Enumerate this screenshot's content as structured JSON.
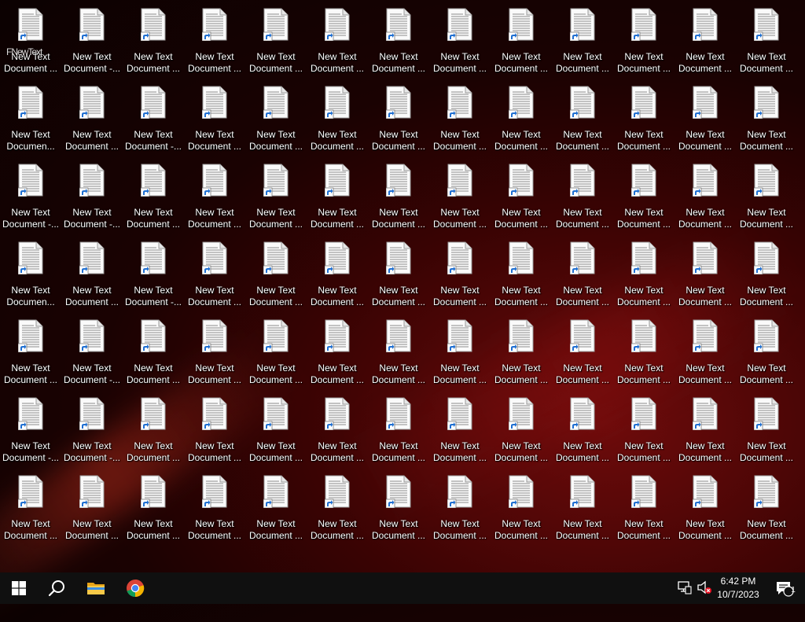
{
  "desktop": {
    "icon_title": "New Text",
    "first_icon_overlay": "FNewText",
    "rows": [
      [
        "Document ...",
        "Document -...",
        "Document ...",
        "Document ...",
        "Document ...",
        "Document ...",
        "Document ...",
        "Document ...",
        "Document ...",
        "Document ...",
        "Document ...",
        "Document ...",
        "Document ..."
      ],
      [
        "Documen...",
        "Document ...",
        "Document -...",
        "Document ...",
        "Document ...",
        "Document ...",
        "Document ...",
        "Document ...",
        "Document ...",
        "Document ...",
        "Document ...",
        "Document ...",
        "Document ..."
      ],
      [
        "Document -...",
        "Document -...",
        "Document ...",
        "Document ...",
        "Document ...",
        "Document ...",
        "Document ...",
        "Document ...",
        "Document ...",
        "Document ...",
        "Document ...",
        "Document ...",
        "Document ..."
      ],
      [
        "Documen...",
        "Document ...",
        "Document -...",
        "Document ...",
        "Document ...",
        "Document ...",
        "Document ...",
        "Document ...",
        "Document ...",
        "Document ...",
        "Document ...",
        "Document ...",
        "Document ..."
      ],
      [
        "Document ...",
        "Document -...",
        "Document ...",
        "Document ...",
        "Document ...",
        "Document ...",
        "Document ...",
        "Document ...",
        "Document ...",
        "Document ...",
        "Document ...",
        "Document ...",
        "Document ..."
      ],
      [
        "Document -...",
        "Document -...",
        "Document ...",
        "Document ...",
        "Document ...",
        "Document ...",
        "Document ...",
        "Document ...",
        "Document ...",
        "Document ...",
        "Document ...",
        "Document ...",
        "Document ..."
      ],
      [
        "Document ...",
        "Document ...",
        "Document ...",
        "Document ...",
        "Document ...",
        "Document ...",
        "Document ...",
        "Document ...",
        "Document ...",
        "Document ...",
        "Document ...",
        "Document ...",
        "Document ..."
      ]
    ]
  },
  "taskbar": {
    "start_icon": "windows-logo-icon",
    "search_icon": "search-icon",
    "apps": [
      "file-explorer-icon",
      "chrome-icon"
    ],
    "tray_icons": [
      "network-icon",
      "volume-muted-icon"
    ],
    "time": "6:42 PM",
    "date": "10/7/2023",
    "notification_count": "1"
  },
  "colors": {
    "taskbar_bg": "#101010",
    "accent": "#3a8ee6",
    "wallpaper_dark": "#0b0101",
    "wallpaper_red": "#6e0b0b"
  }
}
